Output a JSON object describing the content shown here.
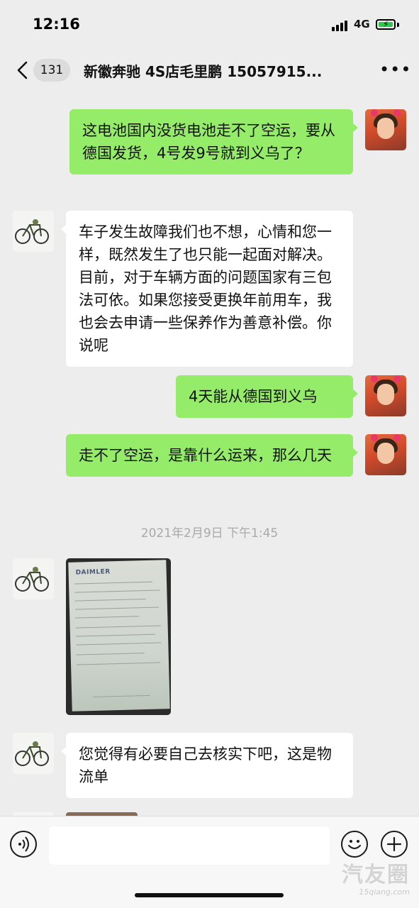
{
  "status_bar": {
    "time": "12:16",
    "network": "4G"
  },
  "header": {
    "unread_count": "131",
    "title": "新徽奔驰 4S店毛里鹏 15057915..."
  },
  "messages": [
    {
      "side": "me",
      "type": "text",
      "text": "这电池国内没货电池走不了空运，要从德国发货，4号发9号就到义乌了？"
    },
    {
      "side": "them",
      "type": "text",
      "text": "车子发生故障我们也不想，心情和您一样，既然发生了也只能一起面对解决。目前，对于车辆方面的问题国家有三包法可依。如果您接受更换年前用车，我也会去申请一些保养作为善意补偿。你说呢"
    },
    {
      "side": "me",
      "type": "text",
      "text": "4天能从德国到义乌"
    },
    {
      "side": "me",
      "type": "text",
      "text": "走不了空运，是靠什么运来，那么几天"
    },
    {
      "type": "timestamp",
      "text": "2021年2月9日 下午1:45"
    },
    {
      "side": "them",
      "type": "image",
      "caption": "DAIMLER"
    },
    {
      "side": "them",
      "type": "text",
      "text": "您觉得有必要自己去核实下吧，这是物流单"
    }
  ],
  "input_bar": {
    "placeholder": ""
  },
  "watermark": {
    "main": "汽友圈",
    "sub": "15qiang.com"
  },
  "colors": {
    "background": "#ededed",
    "my_bubble": "#95ec69",
    "their_bubble": "#ffffff"
  }
}
